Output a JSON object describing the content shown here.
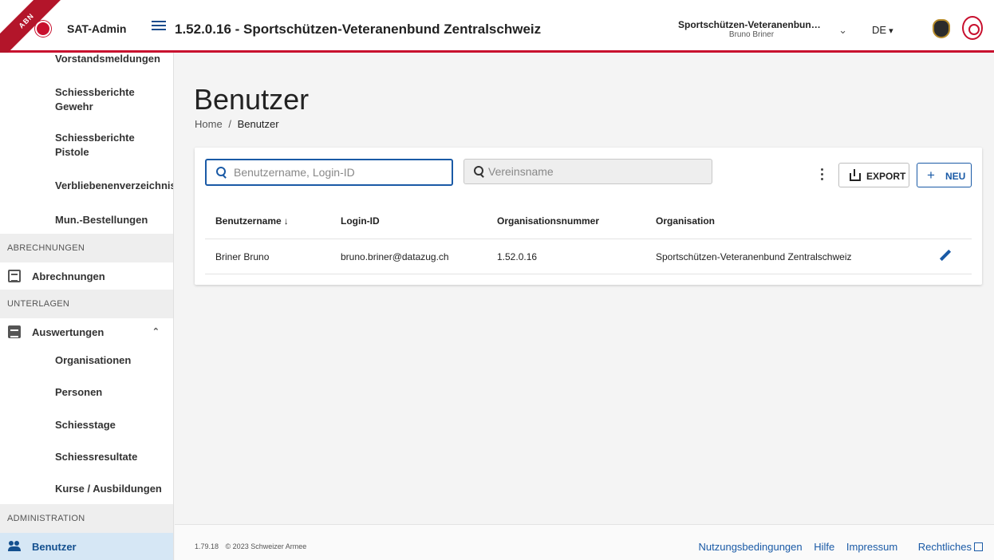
{
  "header": {
    "corner_label": "ABN",
    "app_name": "SAT-Admin",
    "page_title": "1.52.0.16 - Sportschützen-Veteranenbund Zentralschweiz",
    "org_selector": {
      "org": "Sportschützen-Veteranenbund Z...",
      "user": "Bruno Briner"
    },
    "language": "DE"
  },
  "sidebar": {
    "items_top": [
      {
        "label": "Vorstandsmeldungen"
      },
      {
        "label": "Schiessberichte Gewehr"
      },
      {
        "label": "Schiessberichte Pistole"
      },
      {
        "label": "Verbliebenenverzeichnis"
      },
      {
        "label": "Mun.-Bestellungen"
      }
    ],
    "section_abrechnungen": "ABRECHNUNGEN",
    "abrechnungen": "Abrechnungen",
    "section_unterlagen": "UNTERLAGEN",
    "auswertungen": "Auswertungen",
    "auswertungen_items": [
      {
        "label": "Organisationen"
      },
      {
        "label": "Personen"
      },
      {
        "label": "Schiesstage"
      },
      {
        "label": "Schiessresultate"
      },
      {
        "label": "Kurse / Ausbildungen"
      }
    ],
    "section_administration": "ADMINISTRATION",
    "benutzer": "Benutzer"
  },
  "main": {
    "title": "Benutzer",
    "breadcrumb": {
      "home": "Home",
      "separator": "/",
      "current": "Benutzer"
    },
    "search_user_placeholder": "Benutzername, Login-ID",
    "search_club_placeholder": "Vereinsname",
    "export_label": "EXPORT",
    "new_label": "NEU",
    "table": {
      "headers": [
        "Benutzername",
        "Login-ID",
        "Organisationsnummer",
        "Organisation"
      ],
      "sort_indicator": "↓",
      "rows": [
        [
          "Briner Bruno",
          "bruno.briner@datazug.ch",
          "1.52.0.16",
          "Sportschützen-Veteranenbund Zentralschweiz"
        ]
      ]
    }
  },
  "footer": {
    "version": "1.79.18",
    "copyright": "© 2023 Schweizer Armee",
    "links": [
      "Nutzungsbedingungen",
      "Hilfe",
      "Impressum",
      "Rechtliches"
    ]
  },
  "colors": {
    "accent": "#1a5aa6",
    "brand_red": "#c8102e",
    "active_bg": "#d6e7f5"
  },
  "icons": [
    "menu-icon",
    "chevron-down-icon",
    "search-icon",
    "more-vert-icon",
    "export-icon",
    "plus-icon",
    "edit-icon",
    "document-icon",
    "clipboard-icon",
    "people-icon",
    "chevron-up-icon",
    "external-link-icon"
  ]
}
